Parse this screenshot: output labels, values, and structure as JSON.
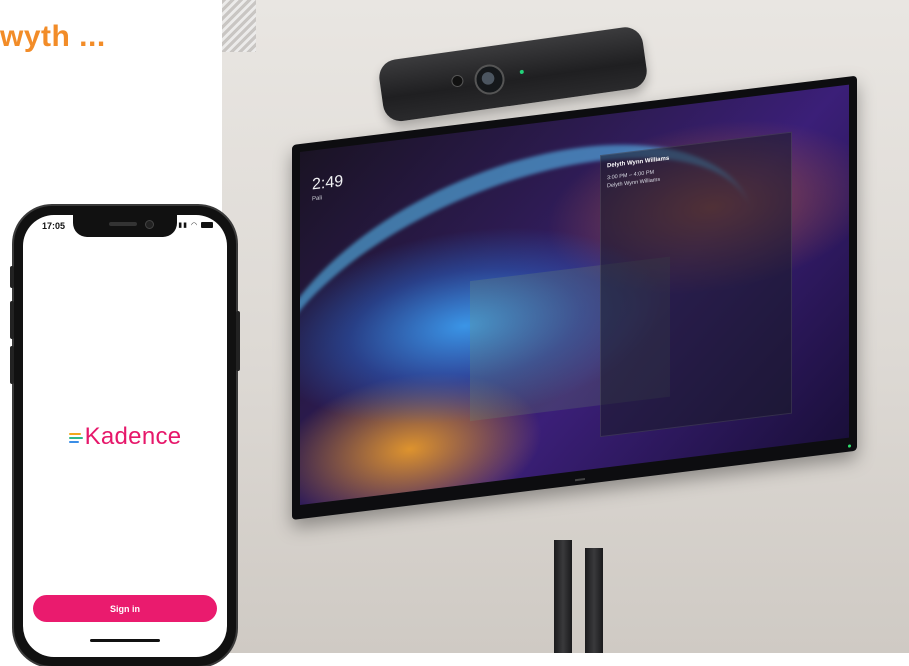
{
  "headline": {
    "text": "wyth ..."
  },
  "phone": {
    "status_time": "17:05",
    "logo_text": "Kadence",
    "sign_in_label": "Sign in"
  },
  "tv": {
    "clock": "2:49",
    "clock_sub": "Pali",
    "event_title": "Delyth Wynn Williams",
    "event_time": "3:00 PM – 4:00 PM",
    "event_organizer": "Delyth Wynn Williams"
  },
  "colors": {
    "headline": "#f28c28",
    "brand_pink": "#ea1b6e",
    "tv_led": "#2ee06d"
  }
}
